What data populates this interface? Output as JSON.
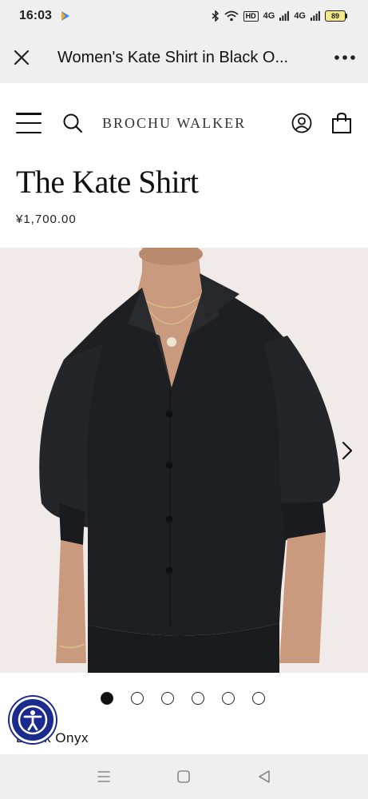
{
  "status_bar": {
    "time": "16:03",
    "network_1": "4G",
    "network_2": "4G",
    "hd_label": "HD",
    "battery": "89"
  },
  "browser": {
    "title": "Women's Kate Shirt in Black O...",
    "close_icon": "close-icon",
    "more_icon": "more-icon"
  },
  "site": {
    "brand": "BROCHU WALKER"
  },
  "product": {
    "title": "The Kate Shirt",
    "price": "¥1,700.00",
    "color": "Black Onyx",
    "image_count": 6,
    "active_image": 1
  },
  "colors": {
    "shirt": "#1e1f22",
    "background": "#f0ebe8",
    "accessibility": "#1b2a8e"
  }
}
